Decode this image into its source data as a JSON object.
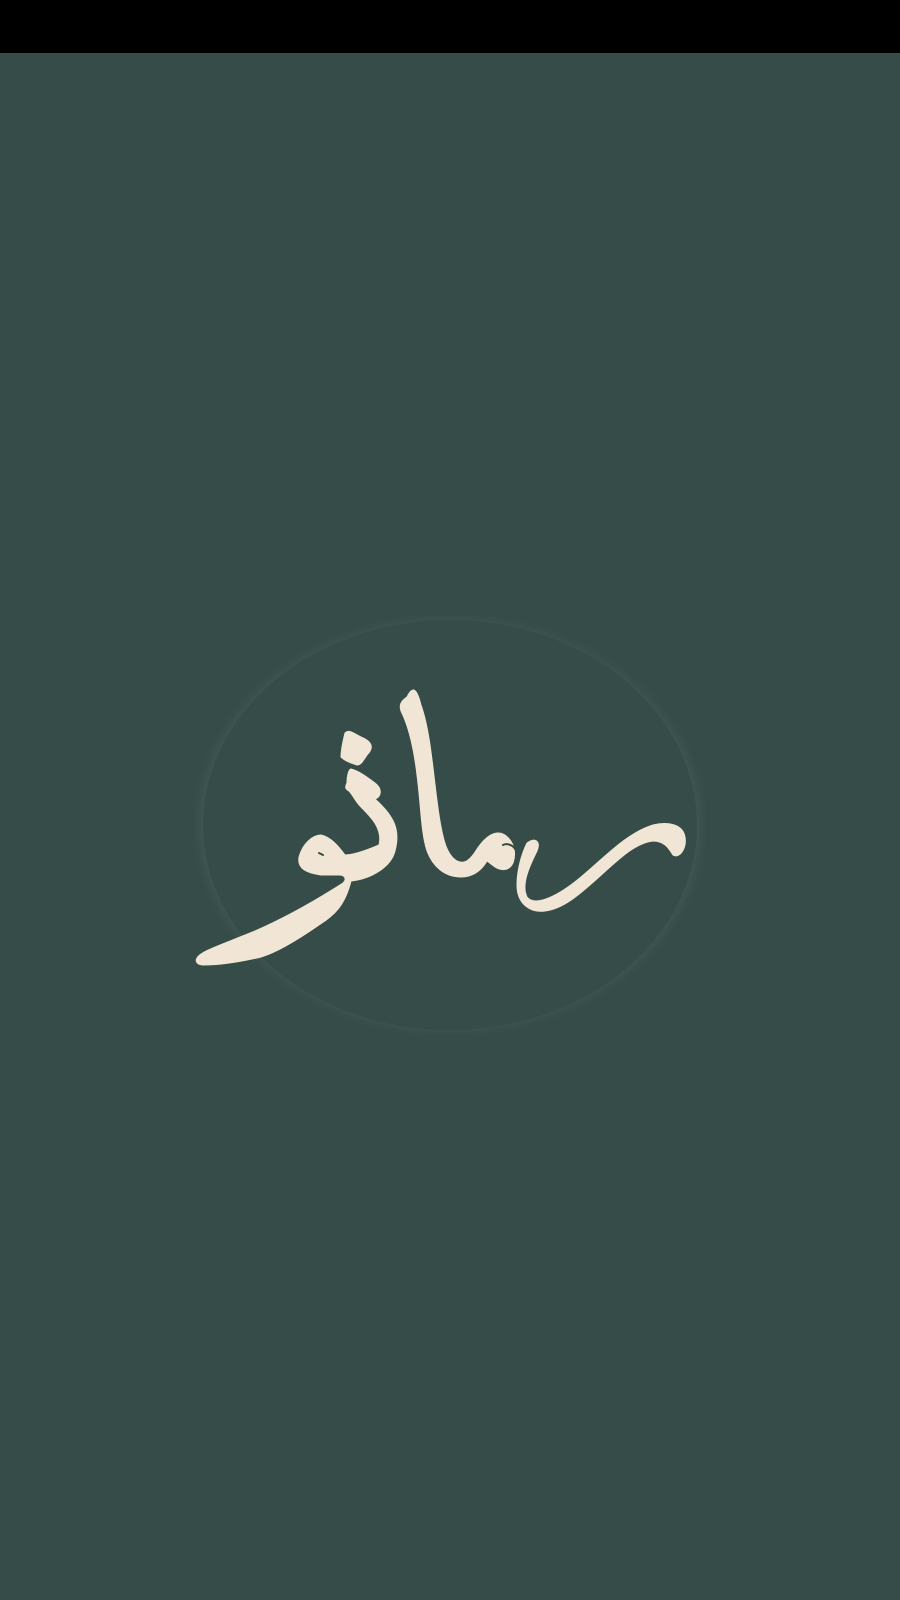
{
  "status_bar": {
    "color": "#000000"
  },
  "splash": {
    "background_color": "#364c49",
    "logo": {
      "type": "calligraphy-logo",
      "glyph_color": "#f1e6d6",
      "halo_color": "#3e534f",
      "text": "رمانو"
    }
  }
}
